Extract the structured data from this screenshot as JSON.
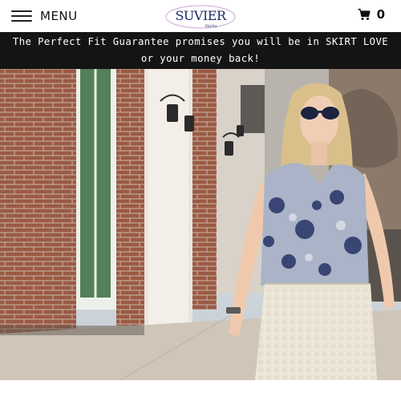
{
  "header": {
    "menu_label": "MENU",
    "menu_icon": "hamburger-icon",
    "logo_text": "SUVIER",
    "logo_subtext": "Skirts",
    "cart_icon": "cart-icon",
    "cart_count": "0"
  },
  "announcement": {
    "text": "The Perfect Fit Guarantee promises you will be in SKIRT LOVE or your money back!"
  },
  "hero": {
    "image": "woman-in-white-lace-skirt-and-floral-top-on-sidewalk"
  },
  "colors": {
    "announcement_bg": "#141414",
    "logo_navy": "#1f2a66"
  }
}
